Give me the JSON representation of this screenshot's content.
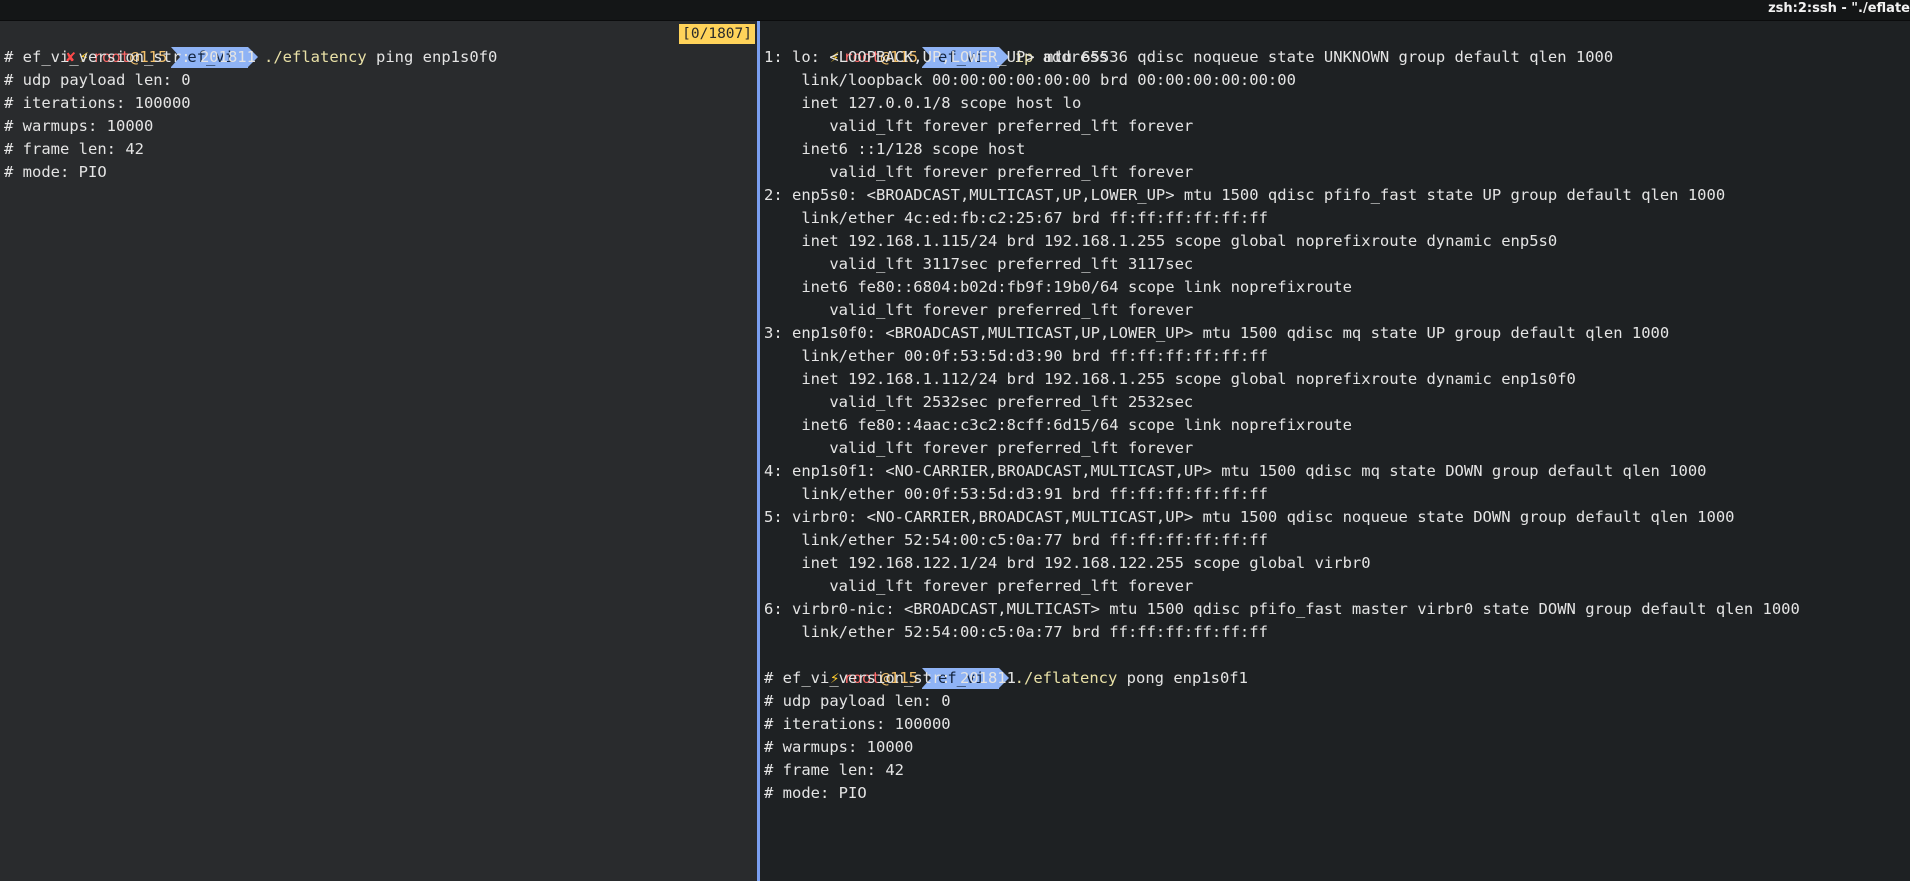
{
  "window": {
    "title": "zsh:2:ssh - \"./eflate"
  },
  "left_pane": {
    "prompt": {
      "error_mark": "✘",
      "bolt": "⚡",
      "user": "root",
      "host": "@115",
      "dir": "ef_vi",
      "command": "./eflatency",
      "args": " ping enp1s0f0"
    },
    "counter": "[0/1807]",
    "output": [
      "# ef_vi_version_str: 201811",
      "# udp payload len: 0",
      "# iterations: 100000",
      "# warmups: 10000",
      "# frame len: 42",
      "# mode: PIO"
    ]
  },
  "right_pane": {
    "prompt1": {
      "bolt": "⚡",
      "user": "root",
      "host": "@115",
      "dir": "ef_vi",
      "command": "ip",
      "args": " address"
    },
    "ip_output": [
      "1: lo: <LOOPBACK,UP,LOWER_UP> mtu 65536 qdisc noqueue state UNKNOWN group default qlen 1000",
      "    link/loopback 00:00:00:00:00:00 brd 00:00:00:00:00:00",
      "    inet 127.0.0.1/8 scope host lo",
      "       valid_lft forever preferred_lft forever",
      "    inet6 ::1/128 scope host",
      "       valid_lft forever preferred_lft forever",
      "2: enp5s0: <BROADCAST,MULTICAST,UP,LOWER_UP> mtu 1500 qdisc pfifo_fast state UP group default qlen 1000",
      "    link/ether 4c:ed:fb:c2:25:67 brd ff:ff:ff:ff:ff:ff",
      "    inet 192.168.1.115/24 brd 192.168.1.255 scope global noprefixroute dynamic enp5s0",
      "       valid_lft 3117sec preferred_lft 3117sec",
      "    inet6 fe80::6804:b02d:fb9f:19b0/64 scope link noprefixroute",
      "       valid_lft forever preferred_lft forever",
      "3: enp1s0f0: <BROADCAST,MULTICAST,UP,LOWER_UP> mtu 1500 qdisc mq state UP group default qlen 1000",
      "    link/ether 00:0f:53:5d:d3:90 brd ff:ff:ff:ff:ff:ff",
      "    inet 192.168.1.112/24 brd 192.168.1.255 scope global noprefixroute dynamic enp1s0f0",
      "       valid_lft 2532sec preferred_lft 2532sec",
      "    inet6 fe80::4aac:c3c2:8cff:6d15/64 scope link noprefixroute",
      "       valid_lft forever preferred_lft forever",
      "4: enp1s0f1: <NO-CARRIER,BROADCAST,MULTICAST,UP> mtu 1500 qdisc mq state DOWN group default qlen 1000",
      "    link/ether 00:0f:53:5d:d3:91 brd ff:ff:ff:ff:ff:ff",
      "5: virbr0: <NO-CARRIER,BROADCAST,MULTICAST,UP> mtu 1500 qdisc noqueue state DOWN group default qlen 1000",
      "    link/ether 52:54:00:c5:0a:77 brd ff:ff:ff:ff:ff:ff",
      "    inet 192.168.122.1/24 brd 192.168.122.255 scope global virbr0",
      "       valid_lft forever preferred_lft forever",
      "6: virbr0-nic: <BROADCAST,MULTICAST> mtu 1500 qdisc pfifo_fast master virbr0 state DOWN group default qlen 1000",
      "    link/ether 52:54:00:c5:0a:77 brd ff:ff:ff:ff:ff:ff"
    ],
    "prompt2": {
      "bolt": "⚡",
      "user": "root",
      "host": "@115",
      "dir": "ef_vi",
      "command": "./eflatency",
      "args": " pong enp1s0f1"
    },
    "pong_output": [
      "# ef_vi_version_str: 201811",
      "# udp payload len: 0",
      "# iterations: 100000",
      "# warmups: 10000",
      "# frame len: 42",
      "# mode: PIO"
    ]
  }
}
